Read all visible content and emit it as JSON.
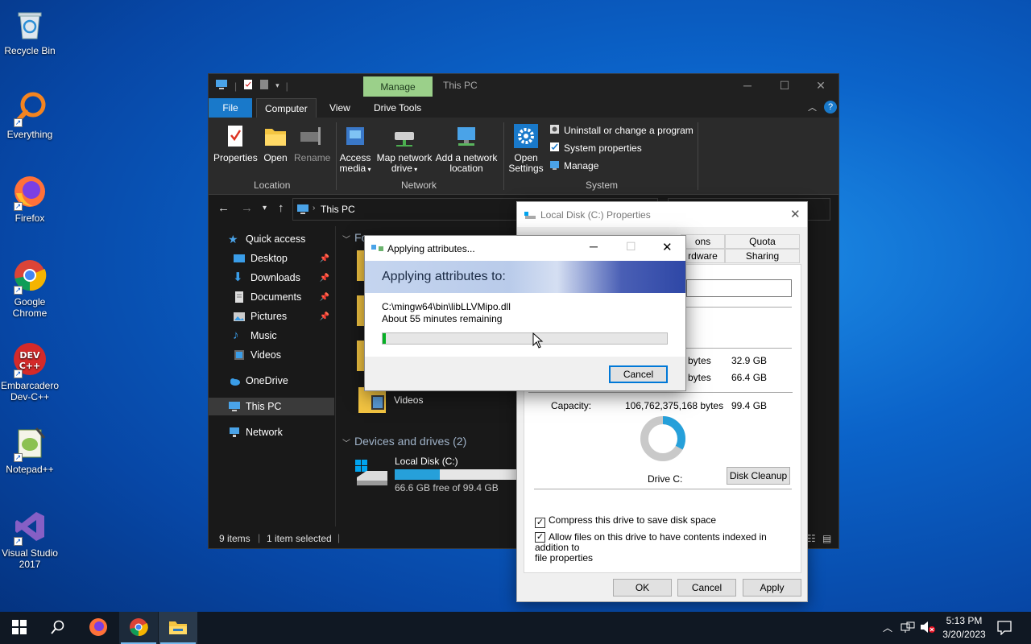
{
  "desktop": {
    "icons": [
      {
        "label": "Recycle Bin"
      },
      {
        "label": "Everything"
      },
      {
        "label": "Firefox"
      },
      {
        "label": "Google Chrome"
      },
      {
        "label": "Embarcadero Dev-C++"
      },
      {
        "label": "Notepad++"
      },
      {
        "label": "Visual Studio 2017"
      }
    ]
  },
  "explorer": {
    "title": "This PC",
    "manage_tab": "Manage",
    "ribbon_tabs": [
      "File",
      "Computer",
      "View",
      "Drive Tools"
    ],
    "ribbon": {
      "properties": "Properties",
      "open": "Open",
      "rename": "Rename",
      "access_media_1": "Access",
      "access_media_2": "media",
      "map_drive_1": "Map network",
      "map_drive_2": "drive",
      "add_location_1": "Add a network",
      "add_location_2": "location",
      "open_settings_1": "Open",
      "open_settings_2": "Settings",
      "uninstall": "Uninstall or change a program",
      "system_properties": "System properties",
      "manage": "Manage",
      "group_location": "Location",
      "group_network": "Network",
      "group_system": "System"
    },
    "address": "This PC",
    "nav": {
      "quick_access": "Quick access",
      "desktop": "Desktop",
      "downloads": "Downloads",
      "documents": "Documents",
      "pictures": "Pictures",
      "music": "Music",
      "videos": "Videos",
      "onedrive": "OneDrive",
      "this_pc": "This PC",
      "network": "Network"
    },
    "content": {
      "folders_header_partial": "Fo",
      "videos_folder": "Videos",
      "devices_header": "Devices and drives (2)",
      "drive_name": "Local Disk (C:)",
      "drive_free": "66.6 GB free of 99.4 GB",
      "drive_used_fraction": 0.33
    },
    "status": {
      "items": "9 items",
      "selected": "1 item selected"
    }
  },
  "properties_dialog": {
    "title": "Local Disk (C:) Properties",
    "tabs_row1": [
      "ons",
      "Quota"
    ],
    "tabs_row2": [
      "rdware",
      "Sharing"
    ],
    "used_bytes_partial": "3 bytes",
    "used_gb": "32.9 GB",
    "free_bytes_partial": "0 bytes",
    "free_gb": "66.4 GB",
    "capacity_label": "Capacity:",
    "capacity_bytes": "106,762,375,168 bytes",
    "capacity_gb": "99.4 GB",
    "used_fraction": 0.33,
    "drive_label": "Drive C:",
    "disk_cleanup": "Disk Cleanup",
    "compress_label": "Compress this drive to save disk space",
    "compress_checked": true,
    "index_label_1": "Allow files on this drive to have contents indexed in addition to",
    "index_label_2": "file properties",
    "index_checked": true,
    "ok": "OK",
    "cancel": "Cancel",
    "apply": "Apply"
  },
  "apply_dialog": {
    "title": "Applying attributes...",
    "heading": "Applying attributes to:",
    "path": "C:\\mingw64\\bin\\libLLVMipo.dll",
    "remaining": "About 55 minutes remaining",
    "progress": 0.01,
    "cancel": "Cancel"
  },
  "taskbar": {
    "time": "5:13 PM",
    "date": "3/20/2023"
  },
  "colors": {
    "accent": "#1979ca",
    "manage_tab": "#9bd08a",
    "progress_green": "#06b025",
    "drive_bar": "#26a0da"
  }
}
